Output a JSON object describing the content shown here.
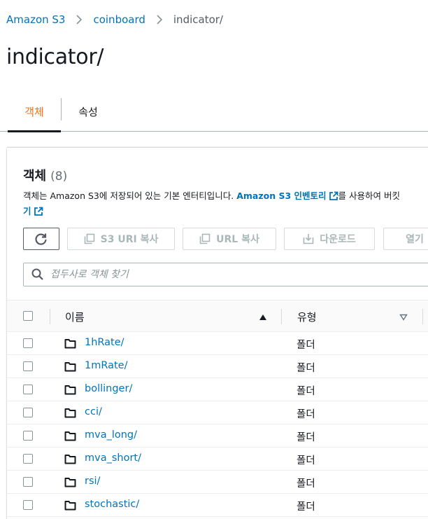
{
  "breadcrumb": {
    "items": [
      "Amazon S3",
      "coinboard"
    ],
    "current": "indicator/"
  },
  "page_title": "indicator/",
  "tabs": [
    {
      "label": "객체",
      "active": true
    },
    {
      "label": "속성",
      "active": false
    }
  ],
  "objects_section": {
    "title": "객체",
    "count": "(8)",
    "description_prefix": "객체는 Amazon S3에 저장되어 있는 기본 엔터티입니다. ",
    "inventory_link": "Amazon S3 인벤토리",
    "description_suffix": "를 사용하여 버킷",
    "description_line2": "기"
  },
  "toolbar": {
    "s3_uri_label": "S3 URI 복사",
    "url_label": "URL 복사",
    "download_label": "다운로드",
    "open_label": "열기"
  },
  "search": {
    "placeholder": "접두사로 객체 찾기",
    "value": ""
  },
  "table": {
    "columns": {
      "name": "이름",
      "type": "유형"
    },
    "rows": [
      {
        "name": "1hRate/",
        "type": "폴더"
      },
      {
        "name": "1mRate/",
        "type": "폴더"
      },
      {
        "name": "bollinger/",
        "type": "폴더"
      },
      {
        "name": "cci/",
        "type": "폴더"
      },
      {
        "name": "mva_long/",
        "type": "폴더"
      },
      {
        "name": "mva_short/",
        "type": "폴더"
      },
      {
        "name": "rsi/",
        "type": "폴더"
      },
      {
        "name": "stochastic/",
        "type": "폴더"
      }
    ]
  },
  "colors": {
    "link": "#0073bb",
    "active_tab": "#ec7211",
    "text": "#16191f",
    "disabled": "#aab7b8"
  }
}
